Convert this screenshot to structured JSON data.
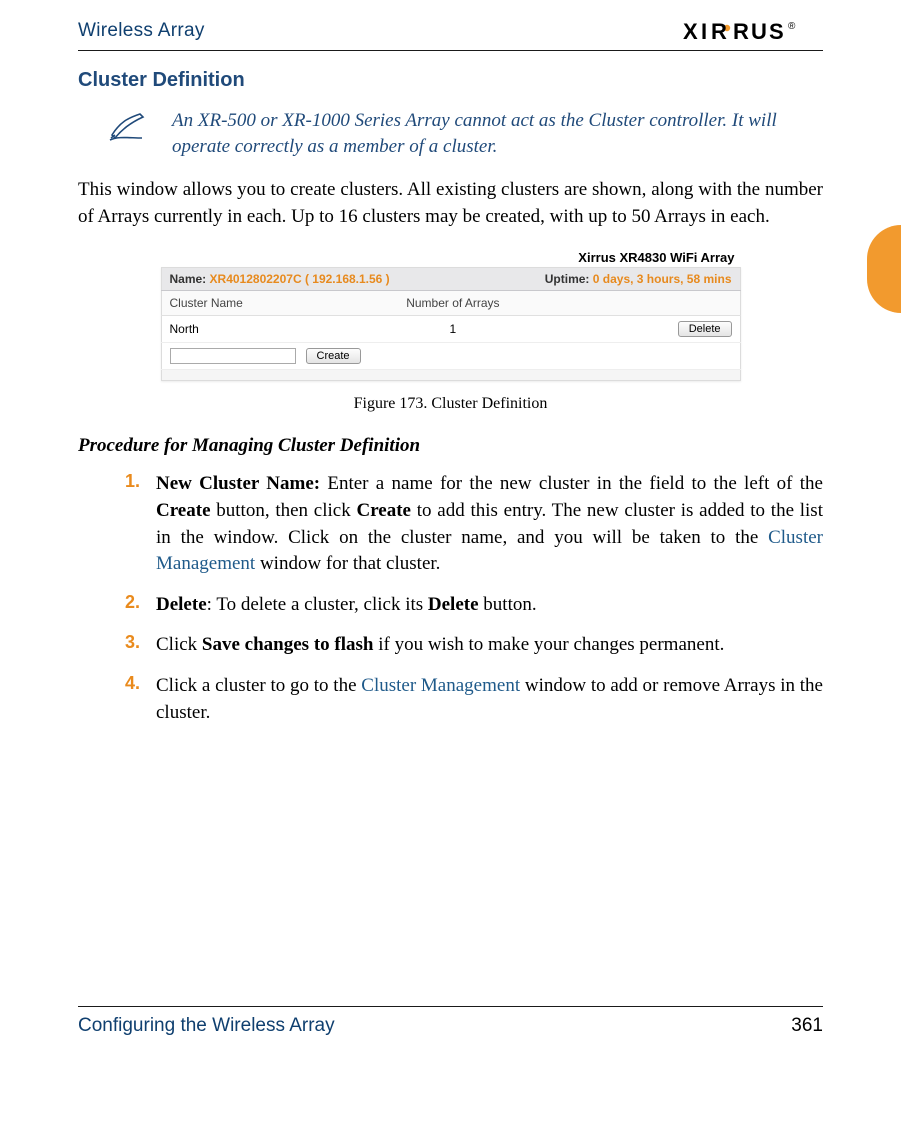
{
  "header": {
    "title": "Wireless Array",
    "logo_text": "XIRRUS"
  },
  "section": {
    "heading": "Cluster Definition"
  },
  "note": {
    "text": "An XR-500 or XR-1000 Series Array cannot act as the Cluster controller. It will operate correctly as a member of a cluster."
  },
  "intro_para": "This window allows you to create clusters. All existing clusters are shown, along with the number of Arrays currently in each. Up to 16 clusters may be created, with up to 50 Arrays in each.",
  "figure": {
    "product_title": "Xirrus XR4830 WiFi Array",
    "name_label": "Name:",
    "name_value": "XR4012802207C",
    "ip_value": "( 192.168.1.56 )",
    "uptime_label": "Uptime:",
    "uptime_value": "0 days, 3 hours, 58 mins",
    "col_cluster": "Cluster Name",
    "col_arrays": "Number of Arrays",
    "row1_name": "North",
    "row1_count": "1",
    "delete_btn": "Delete",
    "create_btn": "Create",
    "new_cluster_placeholder": "",
    "caption": "Figure 173. Cluster Definition"
  },
  "procedure": {
    "title": "Procedure for Managing Cluster Definition",
    "steps": [
      {
        "num": "1.",
        "lead": "New Cluster Name:",
        "part1": " Enter a name for the new cluster in the field to the left of the ",
        "bold1": "Create",
        "part2": " button, then click ",
        "bold2": "Create",
        "part3": " to add this entry. The new cluster is added to the list in the window. Click on the cluster name, and you will be taken to the ",
        "link1": "Cluster Management",
        "part4": " window for that cluster."
      },
      {
        "num": "2.",
        "lead": "Delete",
        "part1": ": To delete a cluster, click its ",
        "bold1": "Delete",
        "part2": " button."
      },
      {
        "num": "3.",
        "part0": "Click ",
        "bold1": "Save changes to flash",
        "part1": " if you wish to make your changes permanent."
      },
      {
        "num": "4.",
        "part0": "Click a cluster to go to the ",
        "link1": "Cluster Management",
        "part1": " window to add or remove Arrays in the cluster."
      }
    ]
  },
  "footer": {
    "left": "Configuring the Wireless Array",
    "page": "361"
  }
}
